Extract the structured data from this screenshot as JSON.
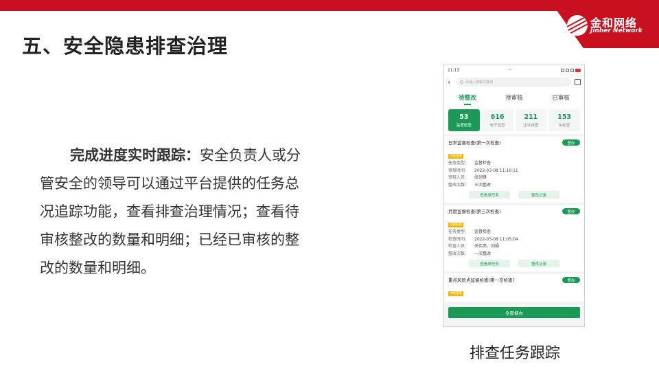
{
  "slide": {
    "title": "五、安全隐患排查治理",
    "lead": "完成进度实时跟踪：",
    "body": "安全负责人或分管安全的领导可以通过平台提供的任务总况追踪功能，查看排查治理情况；查看待审核整改的数量和明细；已经已审核的整改的数量和明细。",
    "caption": "排查任务跟踪"
  },
  "logo": {
    "cn": "金和网络",
    "en": "Jinher Network"
  },
  "phone": {
    "status_time": "11:13",
    "status_more": "···",
    "search_placeholder": "请输入搜索关键词",
    "tabs": [
      "待整改",
      "待审核",
      "已审核"
    ],
    "stats": [
      {
        "num": "53",
        "label": "监督检查"
      },
      {
        "num": "616",
        "label": "电子巡查"
      },
      {
        "num": "211",
        "label": "企业自查"
      },
      {
        "num": "153",
        "label": "AI检查"
      }
    ],
    "cards": [
      {
        "title": "日常监督检查(第一次检查)",
        "button": "督办",
        "tag": "中级隐患",
        "fields": [
          {
            "k": "任务类型:",
            "v": "监督检查"
          },
          {
            "k": "审核时间:",
            "v": "2022-03-08 11:10:11"
          },
          {
            "k": "审核人员:",
            "v": "张剑锋"
          },
          {
            "k": "整改次数:",
            "v": "三次整改"
          }
        ],
        "actions": [
          "查看原任务",
          "整改记录"
        ]
      },
      {
        "title": "月度监督检查(第三次检查)",
        "button": "督办",
        "tag": "中级隐患",
        "fields": [
          {
            "k": "任务类型:",
            "v": "监督检查"
          },
          {
            "k": "检查时间:",
            "v": "2022-03-08 11:05:04"
          },
          {
            "k": "检查人员:",
            "v": "关伟亮、刘娟"
          },
          {
            "k": "整改次数:",
            "v": "一次整改"
          }
        ],
        "actions": [
          "查看原任务",
          "整改记录"
        ]
      },
      {
        "title": "重点风险点监督检查(第一次检查)",
        "button": "督办",
        "tag": "中级隐患"
      }
    ],
    "all_button": "全部督办"
  },
  "colors": {
    "brand_red": "#c8101f",
    "accent_green": "#1a9a56",
    "tag_yellow": "#f4b400"
  }
}
